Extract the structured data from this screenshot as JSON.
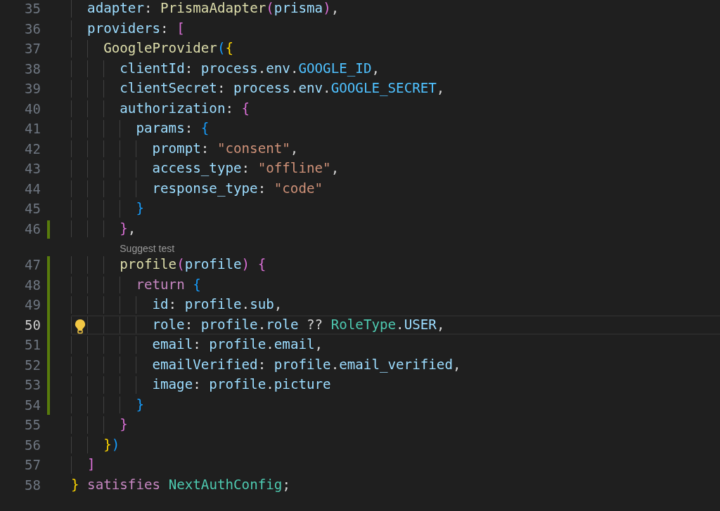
{
  "editor": {
    "lines": [
      {
        "kind": "block",
        "children": [
          {
            "kind": "code",
            "number": "35",
            "modified": false,
            "current": false,
            "lightbulb": false,
            "tokens": [
              {
                "kind": "prop",
                "text": "adapter"
              },
              {
                "kind": "punct",
                "text": ": "
              },
              {
                "kind": "fn",
                "text": "PrismaAdapter"
              },
              {
                "kind": "bracket2",
                "text": "("
              },
              {
                "kind": "prop",
                "text": "prisma"
              },
              {
                "kind": "bracket2",
                "text": ")"
              },
              {
                "kind": "punct",
                "text": ","
              }
            ]
          },
          {
            "kind": "code",
            "number": "36",
            "modified": false,
            "current": false,
            "lightbulb": false,
            "tokens": [
              {
                "kind": "prop",
                "text": "providers"
              },
              {
                "kind": "punct",
                "text": ": "
              },
              {
                "kind": "bracket2",
                "text": "["
              }
            ],
            "children": [
              {
                "kind": "code",
                "number": "37",
                "modified": false,
                "current": false,
                "lightbulb": false,
                "tokens": [
                  {
                    "kind": "fn",
                    "text": "GoogleProvider"
                  },
                  {
                    "kind": "bracket3",
                    "text": "("
                  },
                  {
                    "kind": "bracket1",
                    "text": "{"
                  }
                ],
                "children": [
                  {
                    "kind": "code",
                    "number": "38",
                    "modified": false,
                    "current": false,
                    "lightbulb": false,
                    "tokens": [
                      {
                        "kind": "prop",
                        "text": "clientId"
                      },
                      {
                        "kind": "punct",
                        "text": ": "
                      },
                      {
                        "kind": "prop",
                        "text": "process"
                      },
                      {
                        "kind": "punct",
                        "text": "."
                      },
                      {
                        "kind": "prop",
                        "text": "env"
                      },
                      {
                        "kind": "punct",
                        "text": "."
                      },
                      {
                        "kind": "const",
                        "text": "GOOGLE_ID"
                      },
                      {
                        "kind": "punct",
                        "text": ","
                      }
                    ]
                  },
                  {
                    "kind": "code",
                    "number": "39",
                    "modified": false,
                    "current": false,
                    "lightbulb": false,
                    "tokens": [
                      {
                        "kind": "prop",
                        "text": "clientSecret"
                      },
                      {
                        "kind": "punct",
                        "text": ": "
                      },
                      {
                        "kind": "prop",
                        "text": "process"
                      },
                      {
                        "kind": "punct",
                        "text": "."
                      },
                      {
                        "kind": "prop",
                        "text": "env"
                      },
                      {
                        "kind": "punct",
                        "text": "."
                      },
                      {
                        "kind": "const",
                        "text": "GOOGLE_SECRET"
                      },
                      {
                        "kind": "punct",
                        "text": ","
                      }
                    ]
                  },
                  {
                    "kind": "code",
                    "number": "40",
                    "modified": false,
                    "current": false,
                    "lightbulb": false,
                    "tokens": [
                      {
                        "kind": "prop",
                        "text": "authorization"
                      },
                      {
                        "kind": "punct",
                        "text": ": "
                      },
                      {
                        "kind": "bracket2",
                        "text": "{"
                      }
                    ],
                    "children": [
                      {
                        "kind": "code",
                        "number": "41",
                        "modified": false,
                        "current": false,
                        "lightbulb": false,
                        "tokens": [
                          {
                            "kind": "prop",
                            "text": "params"
                          },
                          {
                            "kind": "punct",
                            "text": ": "
                          },
                          {
                            "kind": "bracket3",
                            "text": "{"
                          }
                        ],
                        "children": [
                          {
                            "kind": "code",
                            "number": "42",
                            "modified": false,
                            "current": false,
                            "lightbulb": false,
                            "tokens": [
                              {
                                "kind": "prop",
                                "text": "prompt"
                              },
                              {
                                "kind": "punct",
                                "text": ": "
                              },
                              {
                                "kind": "string",
                                "text": "\"consent\""
                              },
                              {
                                "kind": "punct",
                                "text": ","
                              }
                            ]
                          },
                          {
                            "kind": "code",
                            "number": "43",
                            "modified": false,
                            "current": false,
                            "lightbulb": false,
                            "tokens": [
                              {
                                "kind": "prop",
                                "text": "access_type"
                              },
                              {
                                "kind": "punct",
                                "text": ": "
                              },
                              {
                                "kind": "string",
                                "text": "\"offline\""
                              },
                              {
                                "kind": "punct",
                                "text": ","
                              }
                            ]
                          },
                          {
                            "kind": "code",
                            "number": "44",
                            "modified": false,
                            "current": false,
                            "lightbulb": false,
                            "tokens": [
                              {
                                "kind": "prop",
                                "text": "response_type"
                              },
                              {
                                "kind": "punct",
                                "text": ": "
                              },
                              {
                                "kind": "string",
                                "text": "\"code\""
                              }
                            ]
                          }
                        ]
                      },
                      {
                        "kind": "code",
                        "number": "45",
                        "modified": false,
                        "current": false,
                        "lightbulb": false,
                        "tokens": [
                          {
                            "kind": "bracket3",
                            "text": "}"
                          }
                        ]
                      }
                    ]
                  },
                  {
                    "kind": "code",
                    "number": "46",
                    "modified": true,
                    "current": false,
                    "lightbulb": false,
                    "tokens": [
                      {
                        "kind": "bracket2",
                        "text": "}"
                      },
                      {
                        "kind": "punct",
                        "text": ","
                      }
                    ]
                  },
                  {
                    "kind": "codelens",
                    "text": "Suggest test"
                  },
                  {
                    "kind": "code",
                    "number": "47",
                    "modified": true,
                    "current": false,
                    "lightbulb": false,
                    "tokens": [
                      {
                        "kind": "fn",
                        "text": "profile"
                      },
                      {
                        "kind": "bracket2",
                        "text": "("
                      },
                      {
                        "kind": "prop",
                        "text": "profile"
                      },
                      {
                        "kind": "bracket2",
                        "text": ")"
                      },
                      {
                        "kind": "bracket2",
                        "text": " {"
                      }
                    ],
                    "children": [
                      {
                        "kind": "code",
                        "number": "48",
                        "modified": true,
                        "current": false,
                        "lightbulb": false,
                        "tokens": [
                          {
                            "kind": "keyword",
                            "text": "return"
                          },
                          {
                            "kind": "bracket3",
                            "text": " {"
                          }
                        ],
                        "children": [
                          {
                            "kind": "code",
                            "number": "49",
                            "modified": true,
                            "current": false,
                            "lightbulb": false,
                            "tokens": [
                              {
                                "kind": "prop",
                                "text": "id"
                              },
                              {
                                "kind": "punct",
                                "text": ": "
                              },
                              {
                                "kind": "prop",
                                "text": "profile"
                              },
                              {
                                "kind": "punct",
                                "text": "."
                              },
                              {
                                "kind": "prop",
                                "text": "sub"
                              },
                              {
                                "kind": "punct",
                                "text": ","
                              }
                            ]
                          },
                          {
                            "kind": "code",
                            "number": "50",
                            "modified": true,
                            "current": true,
                            "lightbulb": true,
                            "tokens": [
                              {
                                "kind": "prop",
                                "text": "role"
                              },
                              {
                                "kind": "punct",
                                "text": ": "
                              },
                              {
                                "kind": "prop",
                                "text": "profile"
                              },
                              {
                                "kind": "punct",
                                "text": "."
                              },
                              {
                                "kind": "prop",
                                "text": "role"
                              },
                              {
                                "kind": "punct",
                                "text": " ?? "
                              },
                              {
                                "kind": "type",
                                "text": "RoleType"
                              },
                              {
                                "kind": "punct",
                                "text": "."
                              },
                              {
                                "kind": "prop",
                                "text": "USER"
                              },
                              {
                                "kind": "punct",
                                "text": ","
                              }
                            ]
                          },
                          {
                            "kind": "code",
                            "number": "51",
                            "modified": true,
                            "current": false,
                            "lightbulb": false,
                            "tokens": [
                              {
                                "kind": "prop",
                                "text": "email"
                              },
                              {
                                "kind": "punct",
                                "text": ": "
                              },
                              {
                                "kind": "prop",
                                "text": "profile"
                              },
                              {
                                "kind": "punct",
                                "text": "."
                              },
                              {
                                "kind": "prop",
                                "text": "email"
                              },
                              {
                                "kind": "punct",
                                "text": ","
                              }
                            ]
                          },
                          {
                            "kind": "code",
                            "number": "52",
                            "modified": true,
                            "current": false,
                            "lightbulb": false,
                            "tokens": [
                              {
                                "kind": "prop",
                                "text": "emailVerified"
                              },
                              {
                                "kind": "punct",
                                "text": ": "
                              },
                              {
                                "kind": "prop",
                                "text": "profile"
                              },
                              {
                                "kind": "punct",
                                "text": "."
                              },
                              {
                                "kind": "prop",
                                "text": "email_verified"
                              },
                              {
                                "kind": "punct",
                                "text": ","
                              }
                            ]
                          },
                          {
                            "kind": "code",
                            "number": "53",
                            "modified": true,
                            "current": false,
                            "lightbulb": false,
                            "tokens": [
                              {
                                "kind": "prop",
                                "text": "image"
                              },
                              {
                                "kind": "punct",
                                "text": ": "
                              },
                              {
                                "kind": "prop",
                                "text": "profile"
                              },
                              {
                                "kind": "punct",
                                "text": "."
                              },
                              {
                                "kind": "prop",
                                "text": "picture"
                              }
                            ]
                          }
                        ]
                      },
                      {
                        "kind": "code",
                        "number": "54",
                        "modified": true,
                        "current": false,
                        "lightbulb": false,
                        "tokens": [
                          {
                            "kind": "bracket3",
                            "text": "}"
                          }
                        ]
                      }
                    ]
                  },
                  {
                    "kind": "code",
                    "number": "55",
                    "modified": false,
                    "current": false,
                    "lightbulb": false,
                    "tokens": [
                      {
                        "kind": "bracket2",
                        "text": "}"
                      }
                    ]
                  }
                ]
              },
              {
                "kind": "code",
                "number": "56",
                "modified": false,
                "current": false,
                "lightbulb": false,
                "tokens": [
                  {
                    "kind": "bracket1",
                    "text": "}"
                  },
                  {
                    "kind": "bracket3",
                    "text": ")"
                  }
                ]
              }
            ]
          },
          {
            "kind": "code",
            "number": "57",
            "modified": false,
            "current": false,
            "lightbulb": false,
            "tokens": [
              {
                "kind": "bracket2",
                "text": "]"
              }
            ]
          }
        ]
      },
      {
        "kind": "code",
        "number": "58",
        "modified": false,
        "current": false,
        "lightbulb": false,
        "tokens": [
          {
            "kind": "bracket1",
            "text": "}"
          },
          {
            "kind": "keyword",
            "text": " satisfies"
          },
          {
            "kind": "type",
            "text": " NextAuthConfig"
          },
          {
            "kind": "punct",
            "text": ";"
          }
        ]
      }
    ]
  }
}
